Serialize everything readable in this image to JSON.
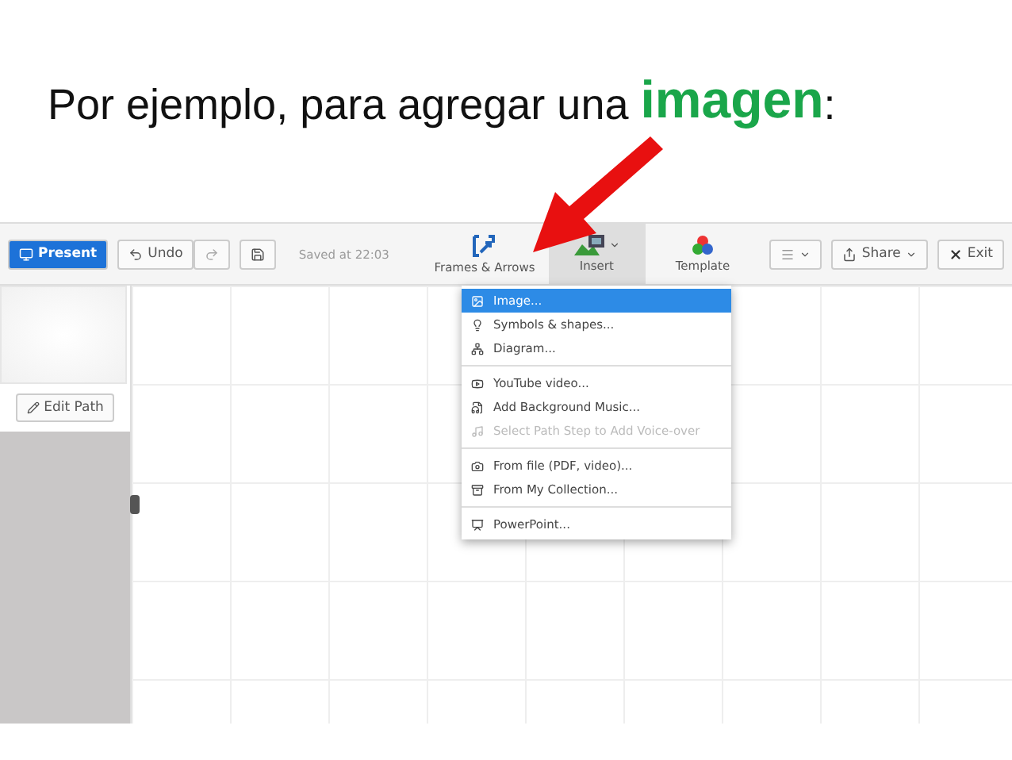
{
  "heading": {
    "text": "Por ejemplo, para agregar una ",
    "highlight": "imagen",
    "end": ":"
  },
  "toolbar": {
    "present": "Present",
    "undo": "Undo",
    "saved": "Saved at 22:03",
    "tools": [
      {
        "kind": "frames",
        "label": "Frames & Arrows",
        "selected": false
      },
      {
        "kind": "insert",
        "label": "Insert",
        "selected": true
      },
      {
        "kind": "template",
        "label": "Template",
        "selected": false
      }
    ],
    "share": "Share",
    "exit": "Exit"
  },
  "sidebar": {
    "edit_path": "Edit Path"
  },
  "insert_menu": [
    [
      {
        "kind": "image",
        "label": "Image...",
        "selected": true,
        "disabled": false
      },
      {
        "kind": "bulb",
        "label": "Symbols & shapes...",
        "selected": false,
        "disabled": false
      },
      {
        "kind": "diagram",
        "label": "Diagram...",
        "selected": false,
        "disabled": false
      }
    ],
    [
      {
        "kind": "youtube",
        "label": "YouTube video...",
        "selected": false,
        "disabled": false
      },
      {
        "kind": "music-file",
        "label": "Add Background Music...",
        "selected": false,
        "disabled": false
      },
      {
        "kind": "note",
        "label": "Select Path Step to Add Voice-over",
        "selected": false,
        "disabled": true
      }
    ],
    [
      {
        "kind": "camera",
        "label": "From file (PDF, video)...",
        "selected": false,
        "disabled": false
      },
      {
        "kind": "box",
        "label": "From My Collection...",
        "selected": false,
        "disabled": false
      }
    ],
    [
      {
        "kind": "slides",
        "label": "PowerPoint...",
        "selected": false,
        "disabled": false
      }
    ]
  ]
}
